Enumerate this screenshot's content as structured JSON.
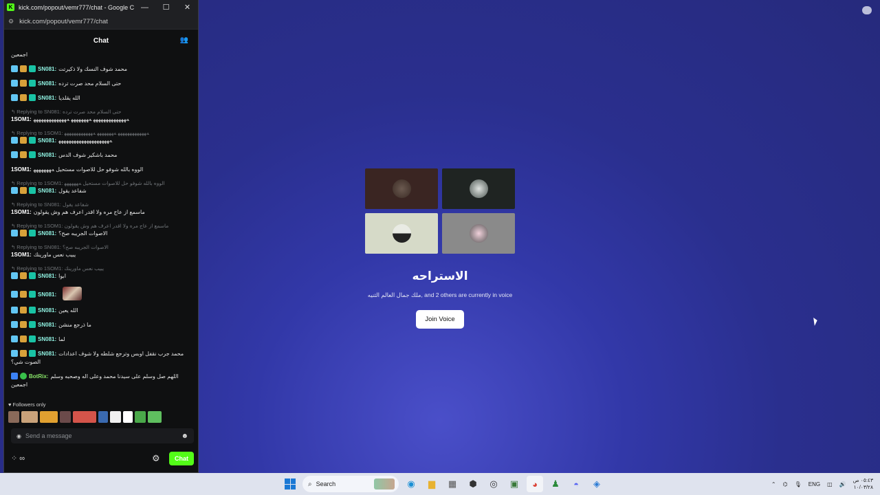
{
  "window": {
    "title": "kick.com/popout/vemr777/chat - Google Chro...",
    "url": "kick.com/popout/vemr777/chat",
    "buttons": {
      "minimize": "—",
      "maximize": "☐",
      "close": "✕"
    }
  },
  "chat": {
    "header": "Chat",
    "top_fragment": "اجمعين",
    "messages": [
      {
        "user": "SN081:",
        "text": "محمد شوف النسك ولا ذكيرتت",
        "badges": [
          "mod",
          "crown",
          "vip"
        ]
      },
      {
        "user": "SN081:",
        "text": "حتى السلام محد صرت ترده",
        "badges": [
          "mod",
          "crown",
          "vip"
        ]
      },
      {
        "user": "SN081:",
        "text": "الله يقلديا",
        "badges": [
          "mod",
          "crown",
          "vip"
        ]
      },
      {
        "reply": "Replying to SN081: حتى السلام محد صرت ترده",
        "user": "1SOM1:",
        "text": "ﻪﻬﻬﻬﻬﻬﻬﻬﻬﻬﻬﻬﻬﻬ ﻪﻬﻬﻬﻬﻬﻬﻬ ﻪﻬﻬﻬﻬﻬﻬﻬﻬﻬﻬﻬﻬﻬ",
        "badges": []
      },
      {
        "reply": "Replying to 1SOM1: ﻪﻬﻬﻬﻬﻬﻬﻬﻬﻬﻬﻬﻬ ﻪﻬﻬﻬﻬﻬﻬﻬ ﻪﻬﻬﻬﻬﻬﻬﻬﻬﻬﻬﻬﻬ",
        "user": "SN081:",
        "text": "ﻪﻬﻬﻬﻬﻬﻬﻬﻬﻬﻬﻬﻬﻬﻬﻬﻬﻬﻬﻬﻬ",
        "badges": [
          "mod",
          "crown",
          "vip"
        ]
      },
      {
        "user": "SN081:",
        "text": "محمد باشكير شوف الدس",
        "badges": [
          "mod",
          "crown",
          "vip"
        ]
      },
      {
        "user": "1SOM1:",
        "text": "الووه بالله شوفو حل للاصوات مستحيل ﻪﻬﻬﻬﻬﻬﻬﻬ",
        "badges": []
      },
      {
        "reply": "Replying to 1SOM1: الووه بالله شوفو حل للاصوات مستحيل ﻪﻬﻬﻬﻬﻬﻬ",
        "user": "SN081:",
        "text": "شفاعد يقول",
        "badges": [
          "mod",
          "crown",
          "vip"
        ]
      },
      {
        "reply": "Replying to SN081: شفاعد يقول",
        "user": "1SOM1:",
        "text": "ماسمع از عاج مره ولا اقدر اعرف هم وش يقولون",
        "badges": []
      },
      {
        "reply": "Replying to 1SOM1: ماسمع از عاج مره ولا اقدر اعرف هم وش يقولون",
        "user": "SN081:",
        "text": "الاصوات الجريبه صح؟",
        "badges": [
          "mod",
          "crown",
          "vip"
        ]
      },
      {
        "reply": "Replying to SN081: الاصوات الجريبه صح؟",
        "user": "1SOM1:",
        "text": "يبيب نعس ماورينك",
        "badges": []
      },
      {
        "reply": "Replying to 1SOM1: يبيب نعس ماورينك",
        "user": "SN081:",
        "text": "ابوا",
        "badges": [
          "mod",
          "crown",
          "vip"
        ]
      },
      {
        "user": "SN081:",
        "text": "",
        "emote": true,
        "badges": [
          "mod",
          "crown",
          "vip"
        ]
      },
      {
        "user": "SN081:",
        "text": "الله يعين",
        "badges": [
          "mod",
          "crown",
          "vip"
        ]
      },
      {
        "user": "SN081:",
        "text": "ما ذرجع منشن",
        "badges": [
          "mod",
          "crown",
          "vip"
        ]
      },
      {
        "user": "SN081:",
        "text": "لما",
        "badges": [
          "mod",
          "crown",
          "vip"
        ]
      },
      {
        "user": "SN081:",
        "text": "محمد جرب نقفل اوبس وترجع شلطه ولا شوف اعدادات الصوت شي؟",
        "badges": [
          "mod",
          "crown",
          "vip"
        ]
      },
      {
        "user": "BotRix:",
        "text": "اللهم صل وسلم على سيدنا محمد وعلى اله وصحبه وسلم اجمعين",
        "badges": [
          "bot",
          "ver"
        ],
        "bot": true
      }
    ],
    "followers_only": "Followers only",
    "input_placeholder": "Send a message",
    "send_label": "Chat"
  },
  "voice": {
    "channel_name": "الاستراحه",
    "status": "ملك جمال العالم الثنيه, and 2 others are currently in voice",
    "join_label": "Join Voice"
  },
  "taskbar": {
    "search_label": "Search",
    "lang": "ENG",
    "time": "٠٥:٤٣ ص",
    "date": "١٠/٠٣/٢٨"
  },
  "colors": {
    "kick_green": "#53fc18",
    "username": "#8ff0e0",
    "bot_username": "#8ae86a"
  }
}
